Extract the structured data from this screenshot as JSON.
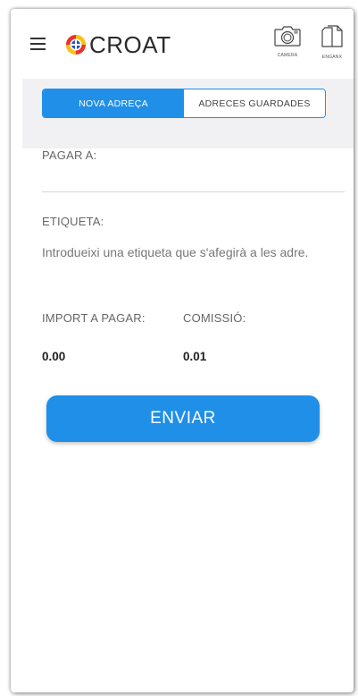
{
  "header": {
    "logo_text": "CROAT",
    "camera_label": "CÀMERA",
    "paste_label": "ENGANX"
  },
  "tabs": [
    {
      "label": "NOVA ADREÇA",
      "active": true
    },
    {
      "label": "ADRECES GUARDADES",
      "active": false
    }
  ],
  "form": {
    "pay_to_label": "PAGAR A:",
    "pay_to_value": "",
    "tag_label": "ETIQUETA:",
    "tag_placeholder": "Introdueixi una etiqueta que s'afegirà a les adre.",
    "amount_label": "IMPORT A PAGAR:",
    "amount_value": "0.00",
    "fee_label": "COMISSIÓ:",
    "fee_value": "0.01",
    "send_label": "ENVIAR"
  },
  "colors": {
    "accent": "#1f8fe8",
    "panel_bg": "#f1f1f3",
    "logo_red": "#e8342a",
    "logo_yellow": "#f5c316",
    "logo_blue": "#2a52be"
  },
  "icons": [
    "menu-icon",
    "croat-logo-icon",
    "camera-icon",
    "paste-icon"
  ]
}
